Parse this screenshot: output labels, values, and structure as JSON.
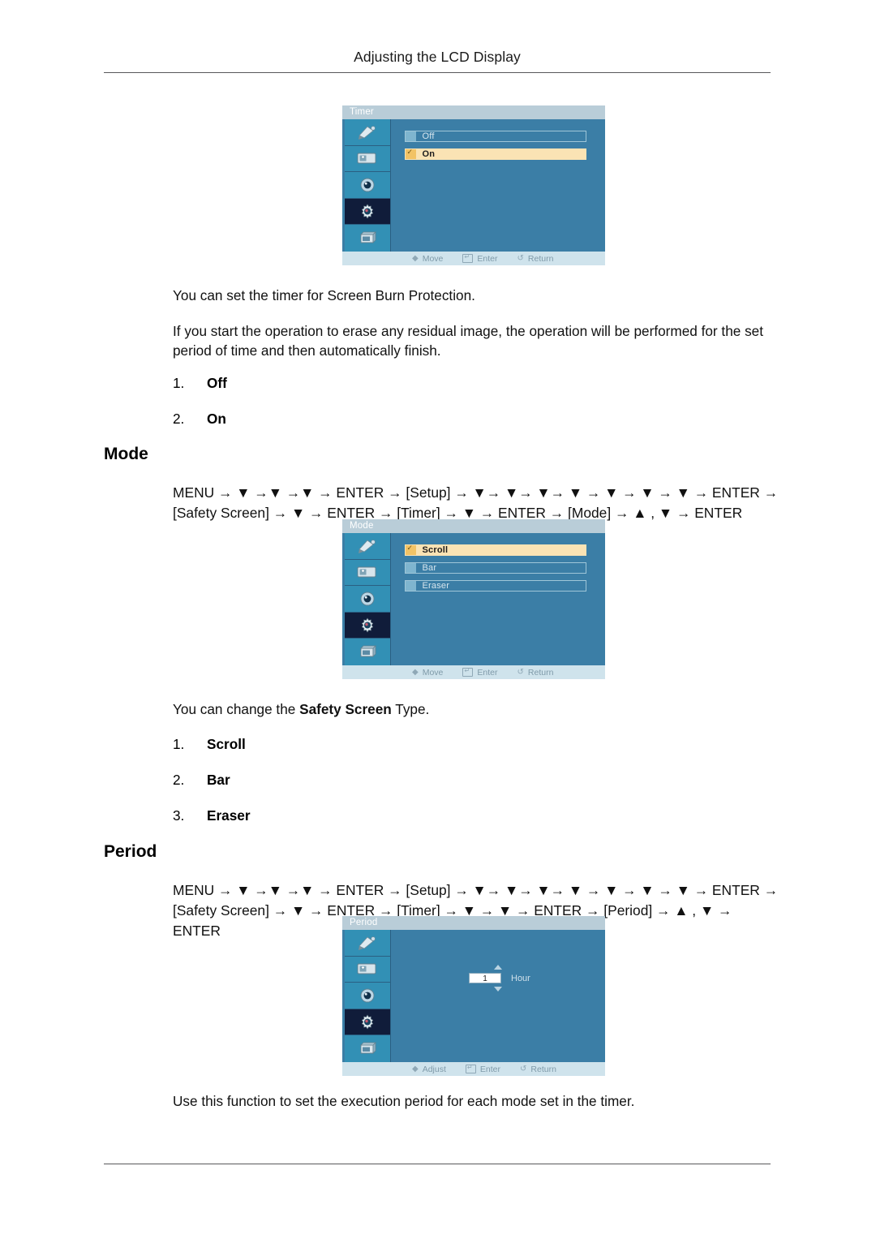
{
  "header": {
    "running_head": "Adjusting the LCD Display"
  },
  "sections": {
    "timer": {
      "osd": {
        "title": "Timer",
        "options": [
          {
            "label": "Off",
            "selected": false
          },
          {
            "label": "On",
            "selected": true
          }
        ],
        "status": [
          {
            "icon": "updown-arrow-icon",
            "label": "Move"
          },
          {
            "icon": "enter-key-icon",
            "label": "Enter"
          },
          {
            "icon": "return-arrow-icon",
            "label": "Return"
          }
        ]
      },
      "para1": "You can set the timer for Screen Burn Protection.",
      "para2": "If you start the operation to erase any residual image, the operation will be performed for the set period of time and then automatically finish.",
      "list": [
        {
          "num": "1.",
          "text": "Off"
        },
        {
          "num": "2.",
          "text": "On"
        }
      ]
    },
    "mode": {
      "heading": "Mode",
      "path_line1": "MENU → ▼ →▼ →▼ → ENTER → [Setup] → ▼→ ▼→ ▼→ ▼ → ▼ → ▼ → ▼ → ENTER → [Safety",
      "path_line2": "Screen] → ▼ → ENTER → [Timer] → ▼ → ENTER → [Mode] → ▲ , ▼ → ENTER",
      "osd": {
        "title": "Mode",
        "options": [
          {
            "label": "Scroll",
            "selected": true
          },
          {
            "label": "Bar",
            "selected": false
          },
          {
            "label": "Eraser",
            "selected": false
          }
        ],
        "status": [
          {
            "icon": "updown-arrow-icon",
            "label": "Move"
          },
          {
            "icon": "enter-key-icon",
            "label": "Enter"
          },
          {
            "icon": "return-arrow-icon",
            "label": "Return"
          }
        ]
      },
      "para_pre": "You can change the ",
      "para_bold": "Safety Screen",
      "para_post": " Type.",
      "list": [
        {
          "num": "1.",
          "text": "Scroll"
        },
        {
          "num": "2.",
          "text": "Bar"
        },
        {
          "num": "3.",
          "text": "Eraser"
        }
      ]
    },
    "period": {
      "heading": "Period",
      "path_line1": "MENU → ▼ →▼ →▼ → ENTER → [Setup] → ▼→ ▼→ ▼→ ▼ → ▼ → ▼ → ▼ → ENTER → [Safety",
      "path_line2": "Screen] → ▼ → ENTER → [Timer] → ▼ → ▼ → ENTER → [Period] → ▲ , ▼ → ENTER",
      "osd": {
        "title": "Period",
        "spinner": {
          "value": "1",
          "unit": "Hour",
          "up_icon": "triangle-up-icon",
          "down_icon": "triangle-down-icon"
        },
        "status": [
          {
            "icon": "updown-arrow-icon",
            "label": "Adjust"
          },
          {
            "icon": "enter-key-icon",
            "label": "Enter"
          },
          {
            "icon": "return-arrow-icon",
            "label": "Return"
          }
        ]
      },
      "para": "Use this function to set the execution period for each mode set in the timer."
    }
  },
  "osd_sidebar_icons": [
    {
      "name": "picture-brush-icon",
      "active": false
    },
    {
      "name": "screen-adjust-icon",
      "active": false
    },
    {
      "name": "sound-icon",
      "active": false
    },
    {
      "name": "setup-gear-icon",
      "active": true
    },
    {
      "name": "multi-control-icon",
      "active": false
    }
  ],
  "colors": {
    "osd_background": "#3b7ea6",
    "osd_sidebar": "#3290b5",
    "osd_active_item": "#101c3a",
    "osd_title_bar": "#b9cdd8",
    "osd_status_bar": "#cfe3ec",
    "osd_selected_row": "#fae3b4",
    "rule": "#58585a"
  }
}
